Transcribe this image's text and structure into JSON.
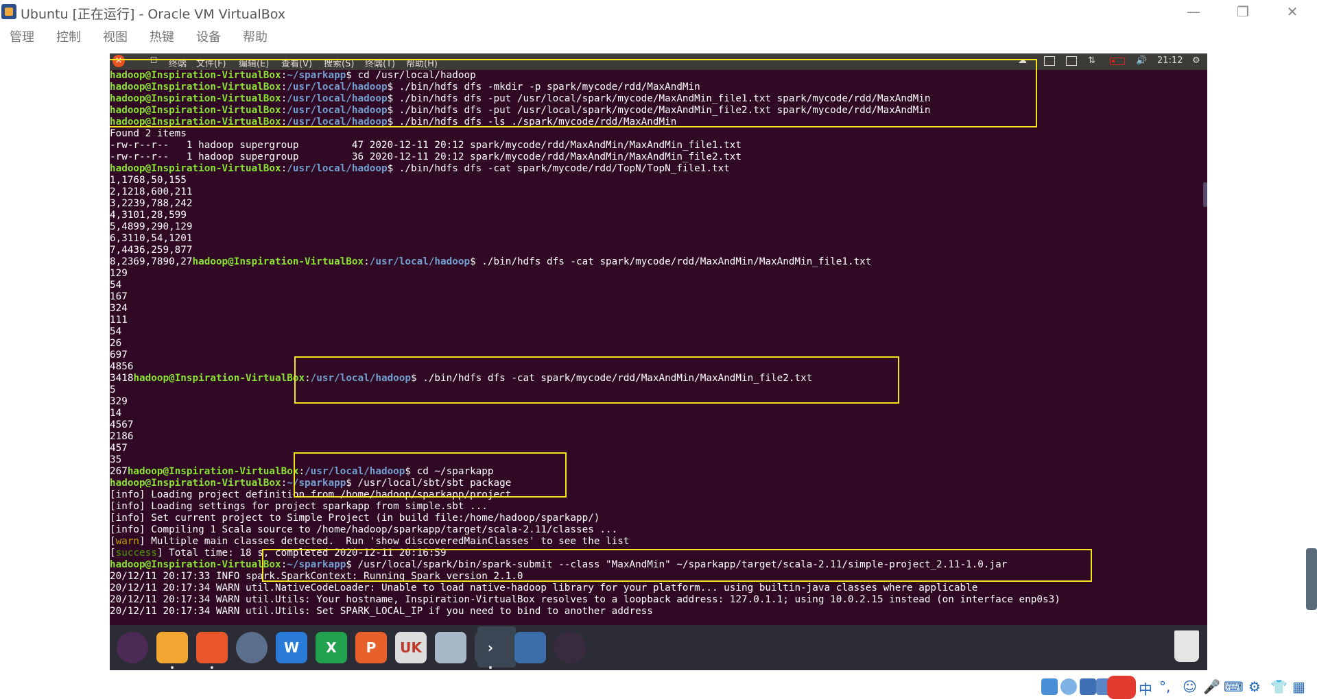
{
  "host": {
    "title": "Ubuntu [正在运行] - Oracle VM VirtualBox",
    "menu": [
      "管理",
      "控制",
      "视图",
      "热键",
      "设备",
      "帮助"
    ],
    "status": {
      "ime_lang": "中",
      "ime_punct": "°,"
    }
  },
  "guest": {
    "topbar": {
      "close": "×",
      "app_title": "终端",
      "menu": [
        "文件(F)",
        "编辑(E)",
        "查看(V)",
        "搜索(S)",
        "终端(T)",
        "帮助(H)"
      ],
      "clock": "21:12"
    }
  },
  "terminal": {
    "lines": [
      {
        "user": "hadoop@Inspiration-VirtualBox",
        "path": "~/sparkapp",
        "cmd": " cd /usr/local/hadoop"
      },
      {
        "user": "hadoop@Inspiration-VirtualBox",
        "path": "/usr/local/hadoop",
        "cmd": " ./bin/hdfs dfs -mkdir -p spark/mycode/rdd/MaxAndMin"
      },
      {
        "user": "hadoop@Inspiration-VirtualBox",
        "path": "/usr/local/hadoop",
        "cmd": " ./bin/hdfs dfs -put /usr/local/spark/mycode/MaxAndMin_file1.txt spark/mycode/rdd/MaxAndMin"
      },
      {
        "user": "hadoop@Inspiration-VirtualBox",
        "path": "/usr/local/hadoop",
        "cmd": " ./bin/hdfs dfs -put /usr/local/spark/mycode/MaxAndMin_file2.txt spark/mycode/rdd/MaxAndMin"
      },
      {
        "user": "hadoop@Inspiration-VirtualBox",
        "path": "/usr/local/hadoop",
        "cmd": " ./bin/hdfs dfs -ls ./spark/mycode/rdd/MaxAndMin"
      },
      {
        "text": "Found 2 items"
      },
      {
        "text": "-rw-r--r--   1 hadoop supergroup         47 2020-12-11 20:12 spark/mycode/rdd/MaxAndMin/MaxAndMin_file1.txt"
      },
      {
        "text": "-rw-r--r--   1 hadoop supergroup         36 2020-12-11 20:12 spark/mycode/rdd/MaxAndMin/MaxAndMin_file2.txt"
      },
      {
        "user": "hadoop@Inspiration-VirtualBox",
        "path": "/usr/local/hadoop",
        "cmd": " ./bin/hdfs dfs -cat spark/mycode/rdd/TopN/TopN_file1.txt"
      },
      {
        "text": "1,1768,50,155"
      },
      {
        "text": "2,1218,600,211"
      },
      {
        "text": "3,2239,788,242"
      },
      {
        "text": "4,3101,28,599"
      },
      {
        "text": "5,4899,290,129"
      },
      {
        "text": "6,3110,54,1201"
      },
      {
        "text": "7,4436,259,877"
      },
      {
        "pre": "8,2369,7890,27",
        "user": "hadoop@Inspiration-VirtualBox",
        "path": "/usr/local/hadoop",
        "cmd": " ./bin/hdfs dfs -cat spark/mycode/rdd/MaxAndMin/MaxAndMin_file1.txt"
      },
      {
        "text": "129"
      },
      {
        "text": "54"
      },
      {
        "text": "167"
      },
      {
        "text": "324"
      },
      {
        "text": "111"
      },
      {
        "text": "54"
      },
      {
        "text": "26"
      },
      {
        "text": "697"
      },
      {
        "text": "4856"
      },
      {
        "pre": "3418",
        "user": "hadoop@Inspiration-VirtualBox",
        "path": "/usr/local/hadoop",
        "cmd": " ./bin/hdfs dfs -cat spark/mycode/rdd/MaxAndMin/MaxAndMin_file2.txt"
      },
      {
        "text": "5"
      },
      {
        "text": "329"
      },
      {
        "text": "14"
      },
      {
        "text": "4567"
      },
      {
        "text": "2186"
      },
      {
        "text": "457"
      },
      {
        "text": "35"
      },
      {
        "pre": "267",
        "user": "hadoop@Inspiration-VirtualBox",
        "path": "/usr/local/hadoop",
        "cmd": " cd ~/sparkapp"
      },
      {
        "user": "hadoop@Inspiration-VirtualBox",
        "path": "~/sparkapp",
        "cmd": " /usr/local/sbt/sbt package"
      },
      {
        "text": "[info] Loading project definition from /home/hadoop/sparkapp/project"
      },
      {
        "text": "[info] Loading settings for project sparkapp from simple.sbt ..."
      },
      {
        "text": "[info] Set current project to Simple Project (in build file:/home/hadoop/sparkapp/)"
      },
      {
        "text": "[info] Compiling 1 Scala source to /home/hadoop/sparkapp/target/scala-2.11/classes ..."
      },
      {
        "tag": "warn",
        "text": " Multiple main classes detected.  Run 'show discoveredMainClasses' to see the list"
      },
      {
        "tag": "success",
        "text": " Total time: 18 s, completed 2020-12-11 20:16:59"
      },
      {
        "user": "hadoop@Inspiration-VirtualBox",
        "path": "~/sparkapp",
        "cmd": " /usr/local/spark/bin/spark-submit --class \"MaxAndMin\" ~/sparkapp/target/scala-2.11/simple-project_2.11-1.0.jar"
      },
      {
        "text": "20/12/11 20:17:33 INFO spark.SparkContext: Running Spark version 2.1.0"
      },
      {
        "text": "20/12/11 20:17:34 WARN util.NativeCodeLoader: Unable to load native-hadoop library for your platform... using builtin-java classes where applicable"
      },
      {
        "text": "20/12/11 20:17:34 WARN util.Utils: Your hostname, Inspiration-VirtualBox resolves to a loopback address: 127.0.1.1; using 10.0.2.15 instead (on interface enp0s3)"
      },
      {
        "text": "20/12/11 20:17:34 WARN util.Utils: Set SPARK_LOCAL_IP if you need to bind to another address"
      }
    ]
  },
  "dock": {
    "apps": [
      {
        "name": "ubuntu-icon",
        "color": "#4b2a55"
      },
      {
        "name": "files-icon",
        "color": "#f0a630"
      },
      {
        "name": "firefox-icon",
        "color": "#e8562a"
      },
      {
        "name": "chromium-icon",
        "color": "#5b6f8c"
      },
      {
        "name": "writer-icon",
        "color": "#2a7bd8",
        "label": "W"
      },
      {
        "name": "calc-icon",
        "color": "#22a14f",
        "label": "X"
      },
      {
        "name": "impress-icon",
        "color": "#e8602c",
        "label": "P"
      },
      {
        "name": "software-icon",
        "color": "#dddddd",
        "label": "UK"
      },
      {
        "name": "ssh-icon",
        "color": "#a8b8c8"
      },
      {
        "name": "terminal-icon",
        "color": "#3a4653",
        "label": "›"
      },
      {
        "name": "workspaces-icon",
        "color": "#3b6ea8"
      },
      {
        "name": "rhythmbox-icon",
        "color": "#3a2a40"
      }
    ]
  },
  "colors": {
    "terminal_bg": "#300a24",
    "prompt_user": "#8ae234",
    "prompt_path": "#729fcf",
    "highlight": "#f5e51a"
  }
}
